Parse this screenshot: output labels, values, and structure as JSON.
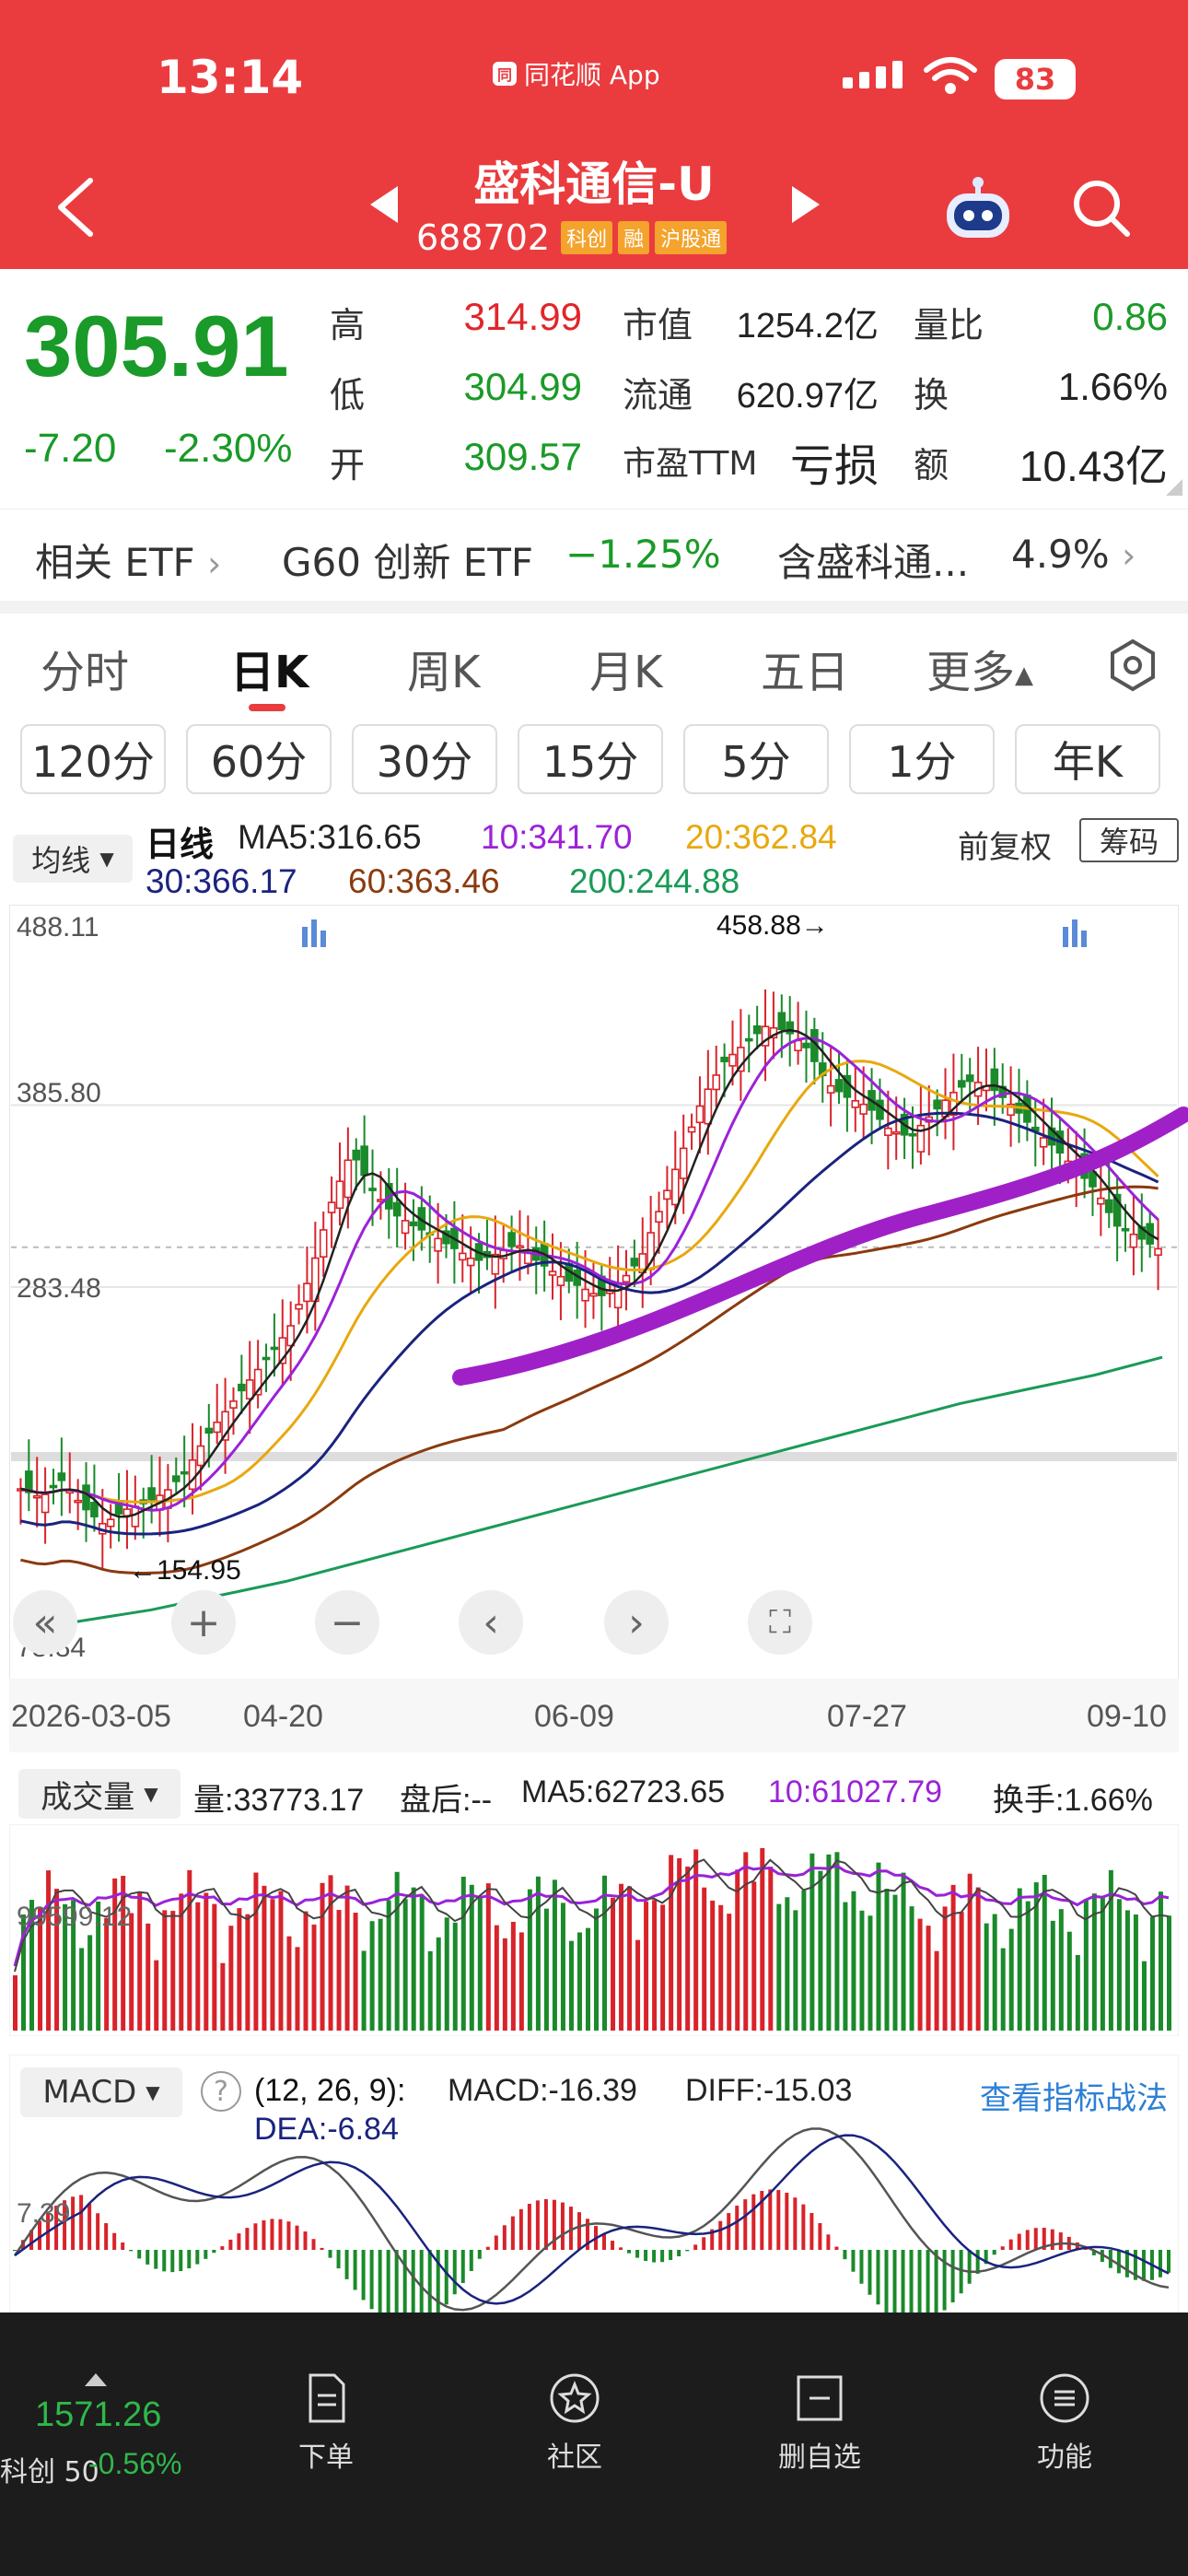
{
  "status": {
    "time": "13:14",
    "app": "同花顺 App",
    "battery": "83"
  },
  "stock": {
    "name": "盛科通信-U",
    "code": "688702",
    "tags": [
      "科创",
      "融",
      "沪股通"
    ]
  },
  "quote": {
    "price": "305.91",
    "change": "-7.20",
    "change_pct": "-2.30%",
    "high_label": "高",
    "high": "314.99",
    "low_label": "低",
    "low": "304.99",
    "open_label": "开",
    "open": "309.57",
    "mktcap_label": "市值",
    "mktcap": "1254.2亿",
    "float_label": "流通",
    "float": "620.97亿",
    "pe_label": "市盈TTM",
    "pe": "亏损",
    "volratio_label": "量比",
    "volratio": "0.86",
    "turnover_label": "换",
    "turnover": "1.66%",
    "amount_label": "额",
    "amount": "10.43亿"
  },
  "etf": {
    "label": "相关 ETF",
    "name": "G60 创新 ETF",
    "change": "−1.25%",
    "contains": "含盛科通...",
    "weight": "4.9%"
  },
  "period_tabs": [
    "分时",
    "日K",
    "周K",
    "月K",
    "五日",
    "更多"
  ],
  "active_tab": "日K",
  "minute_buttons": [
    "120分",
    "60分",
    "30分",
    "15分",
    "5分",
    "1分",
    "年K"
  ],
  "chart_header": {
    "indicator": "均线",
    "line_type": "日线",
    "ma5": "MA5:316.65",
    "ma10": "10:341.70",
    "ma20": "20:362.84",
    "ma30": "30:366.17",
    "ma60": "60:363.46",
    "ma200": "200:244.88",
    "adjust": "前复权",
    "chip": "筹码"
  },
  "colors": {
    "ma5": "#222222",
    "ma10": "#9b22d8",
    "ma20": "#e8a80e",
    "ma30": "#1a237e",
    "ma60": "#8b3a0e",
    "ma200": "#1a9a58",
    "up": "#d8232a",
    "down": "#1a8a2a",
    "trend": "#a020c8"
  },
  "price_axis": {
    "top": "488.11",
    "mid": "385.80",
    "lower": "283.48",
    "bottom": "78.84"
  },
  "annotations": {
    "high": "458.88→",
    "low": "←154.95"
  },
  "dates": [
    "2026-03-05",
    "04-20",
    "06-09",
    "07-27",
    "09-10"
  ],
  "volume": {
    "indicator": "成交量",
    "vol": "量:33773.17",
    "after": "盘后:--",
    "ma5": "MA5:62723.65",
    "ma10": "10:61027.79",
    "turnover": "换手:1.66%",
    "axis": "99599.12"
  },
  "macd": {
    "indicator": "MACD",
    "params": "(12, 26, 9):",
    "macd": "MACD:-16.39",
    "diff": "DIFF:-15.03",
    "dea": "DEA:-6.84",
    "link": "查看指标战法",
    "axis": "7.39"
  },
  "bottom_nav": {
    "index_value": "1571.26",
    "index_name": "科创 50",
    "index_change": "-0.56%",
    "items": [
      "下单",
      "社区",
      "删自选",
      "功能"
    ]
  },
  "chart_data": {
    "type": "candlestick",
    "x": [
      "2026-03-05",
      "04-20",
      "06-09",
      "07-27",
      "09-10"
    ],
    "ylim": [
      78.84,
      488.11
    ],
    "yticks": [
      488.11,
      385.8,
      283.48,
      78.84
    ],
    "annotations": [
      {
        "label": "458.88",
        "value": 458.88
      },
      {
        "label": "154.95",
        "value": 154.95
      }
    ],
    "close_path": [
      170,
      165,
      175,
      160,
      150,
      158,
      162,
      168,
      180,
      200,
      215,
      230,
      245,
      260,
      290,
      330,
      360,
      338,
      325,
      318,
      312,
      305,
      298,
      302,
      308,
      298,
      290,
      284,
      278,
      286,
      300,
      330,
      360,
      390,
      410,
      420,
      430,
      428,
      418,
      398,
      390,
      385,
      372,
      368,
      380,
      392,
      400,
      395,
      385,
      372,
      362,
      350,
      338,
      318,
      312,
      305
    ],
    "ma200_path": [
      90,
      96,
      102,
      110,
      118,
      128,
      138,
      148,
      158,
      168,
      178,
      188,
      198,
      208,
      218,
      226,
      234,
      244
    ]
  }
}
